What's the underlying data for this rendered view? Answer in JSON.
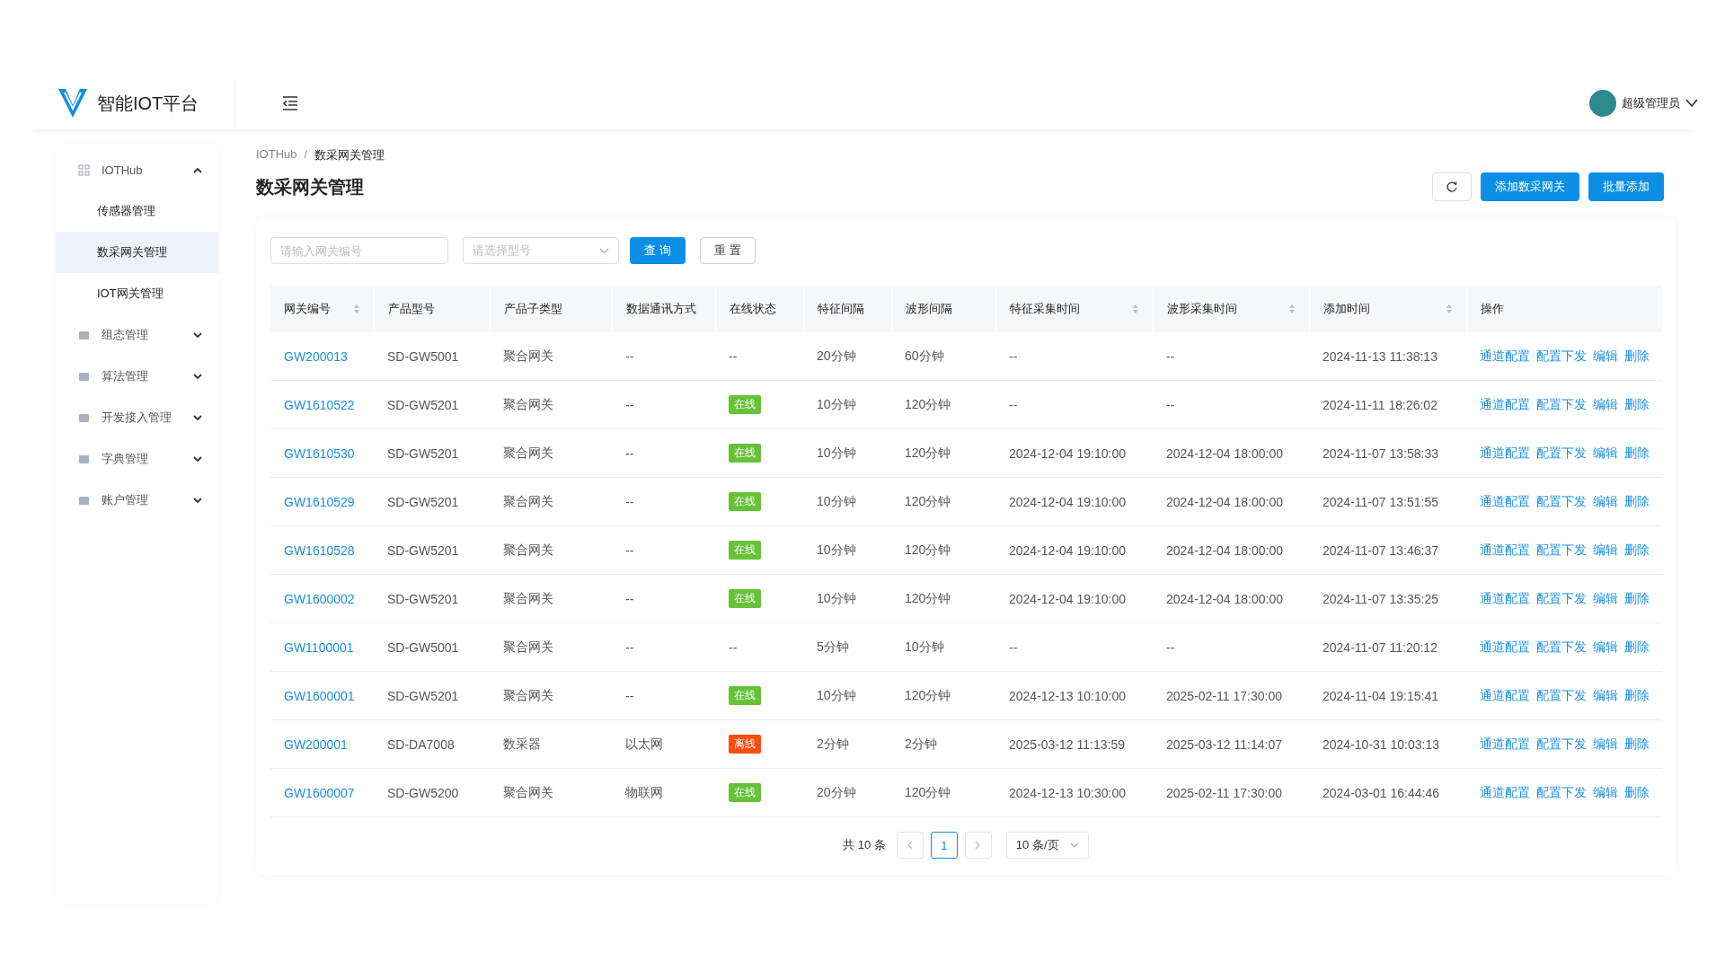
{
  "header": {
    "app_name": "智能IOT平台",
    "user_name": "超级管理员"
  },
  "sidebar": {
    "items": [
      {
        "label": "IOTHub",
        "expanded": true,
        "children": [
          {
            "label": "传感器管理",
            "selected": false
          },
          {
            "label": "数采网关管理",
            "selected": true
          },
          {
            "label": "IOT网关管理",
            "selected": false
          }
        ]
      },
      {
        "label": "组态管理",
        "expanded": false
      },
      {
        "label": "算法管理",
        "expanded": false
      },
      {
        "label": "开发接入管理",
        "expanded": false
      },
      {
        "label": "字典管理",
        "expanded": false
      },
      {
        "label": "账户管理",
        "expanded": false
      }
    ]
  },
  "breadcrumb": {
    "separator": "/",
    "items": [
      "IOTHub",
      "数采网关管理"
    ]
  },
  "page_title": "数采网关管理",
  "toolbar": {
    "buttons": [
      "添加数采网关",
      "批量添加"
    ]
  },
  "filters": {
    "gateway_placeholder": "请输入网关编号",
    "model_placeholder": "请选择型号",
    "query": "查 询",
    "reset": "重 置"
  },
  "table": {
    "columns": [
      {
        "label": "网关编号",
        "sortable": true
      },
      {
        "label": "产品型号",
        "sortable": false
      },
      {
        "label": "产品子类型",
        "sortable": false
      },
      {
        "label": "数据通讯方式",
        "sortable": false
      },
      {
        "label": "在线状态",
        "sortable": false
      },
      {
        "label": "特征间隔",
        "sortable": false
      },
      {
        "label": "波形间隔",
        "sortable": false
      },
      {
        "label": "特征采集时间",
        "sortable": true
      },
      {
        "label": "波形采集时间",
        "sortable": true
      },
      {
        "label": "添加时间",
        "sortable": true
      },
      {
        "label": "操作",
        "sortable": false
      }
    ],
    "rows": [
      {
        "id": "GW200013",
        "model": "SD-GW5001",
        "subtype": "聚合网关",
        "comm": "--",
        "status": {
          "text": "--",
          "kind": "none"
        },
        "feature_interval": "20分钟",
        "wave_interval": "60分钟",
        "feature_time": "--",
        "wave_time": "--",
        "added": "2024-11-13 11:38:13",
        "actions": [
          "通道配置",
          "配置下发",
          "编辑",
          "删除"
        ]
      },
      {
        "id": "GW1610522",
        "model": "SD-GW5201",
        "subtype": "聚合网关",
        "comm": "--",
        "status": {
          "text": "在线",
          "kind": "online"
        },
        "feature_interval": "10分钟",
        "wave_interval": "120分钟",
        "feature_time": "--",
        "wave_time": "--",
        "added": "2024-11-11 18:26:02",
        "actions": [
          "通道配置",
          "配置下发",
          "编辑",
          "删除"
        ]
      },
      {
        "id": "GW1610530",
        "model": "SD-GW5201",
        "subtype": "聚合网关",
        "comm": "--",
        "status": {
          "text": "在线",
          "kind": "online"
        },
        "feature_interval": "10分钟",
        "wave_interval": "120分钟",
        "feature_time": "2024-12-04 19:10:00",
        "wave_time": "2024-12-04 18:00:00",
        "added": "2024-11-07 13:58:33",
        "actions": [
          "通道配置",
          "配置下发",
          "编辑",
          "删除"
        ]
      },
      {
        "id": "GW1610529",
        "model": "SD-GW5201",
        "subtype": "聚合网关",
        "comm": "--",
        "status": {
          "text": "在线",
          "kind": "online"
        },
        "feature_interval": "10分钟",
        "wave_interval": "120分钟",
        "feature_time": "2024-12-04 19:10:00",
        "wave_time": "2024-12-04 18:00:00",
        "added": "2024-11-07 13:51:55",
        "actions": [
          "通道配置",
          "配置下发",
          "编辑",
          "删除"
        ]
      },
      {
        "id": "GW1610528",
        "model": "SD-GW5201",
        "subtype": "聚合网关",
        "comm": "--",
        "status": {
          "text": "在线",
          "kind": "online"
        },
        "feature_interval": "10分钟",
        "wave_interval": "120分钟",
        "feature_time": "2024-12-04 19:10:00",
        "wave_time": "2024-12-04 18:00:00",
        "added": "2024-11-07 13:46:37",
        "actions": [
          "通道配置",
          "配置下发",
          "编辑",
          "删除"
        ]
      },
      {
        "id": "GW1600002",
        "model": "SD-GW5201",
        "subtype": "聚合网关",
        "comm": "--",
        "status": {
          "text": "在线",
          "kind": "online"
        },
        "feature_interval": "10分钟",
        "wave_interval": "120分钟",
        "feature_time": "2024-12-04 19:10:00",
        "wave_time": "2024-12-04 18:00:00",
        "added": "2024-11-07 13:35:25",
        "actions": [
          "通道配置",
          "配置下发",
          "编辑",
          "删除"
        ]
      },
      {
        "id": "GW1100001",
        "model": "SD-GW5001",
        "subtype": "聚合网关",
        "comm": "--",
        "status": {
          "text": "--",
          "kind": "none"
        },
        "feature_interval": "5分钟",
        "wave_interval": "10分钟",
        "feature_time": "--",
        "wave_time": "--",
        "added": "2024-11-07 11:20:12",
        "actions": [
          "通道配置",
          "配置下发",
          "编辑",
          "删除"
        ]
      },
      {
        "id": "GW1600001",
        "model": "SD-GW5201",
        "subtype": "聚合网关",
        "comm": "--",
        "status": {
          "text": "在线",
          "kind": "online"
        },
        "feature_interval": "10分钟",
        "wave_interval": "120分钟",
        "feature_time": "2024-12-13 10:10:00",
        "wave_time": "2025-02-11 17:30:00",
        "added": "2024-11-04 19:15:41",
        "actions": [
          "通道配置",
          "配置下发",
          "编辑",
          "删除"
        ]
      },
      {
        "id": "GW200001",
        "model": "SD-DA7008",
        "subtype": "数采器",
        "comm": "以太网",
        "status": {
          "text": "离线",
          "kind": "offline"
        },
        "feature_interval": "2分钟",
        "wave_interval": "2分钟",
        "feature_time": "2025-03-12 11:13:59",
        "wave_time": "2025-03-12 11:14:07",
        "added": "2024-10-31 10:03:13",
        "actions": [
          "通道配置",
          "配置下发",
          "编辑",
          "删除"
        ]
      },
      {
        "id": "GW1600007",
        "model": "SD-GW5200",
        "subtype": "聚合网关",
        "comm": "物联网",
        "status": {
          "text": "在线",
          "kind": "online"
        },
        "feature_interval": "20分钟",
        "wave_interval": "120分钟",
        "feature_time": "2024-12-13 10:30:00",
        "wave_time": "2025-02-11 17:30:00",
        "added": "2024-03-01 16:44:46",
        "actions": [
          "通道配置",
          "配置下发",
          "编辑",
          "删除"
        ]
      }
    ]
  },
  "pagination": {
    "total": "共 10 条",
    "pages": [
      {
        "label": "1",
        "selected": true
      }
    ],
    "page_size": "10 条/页"
  }
}
